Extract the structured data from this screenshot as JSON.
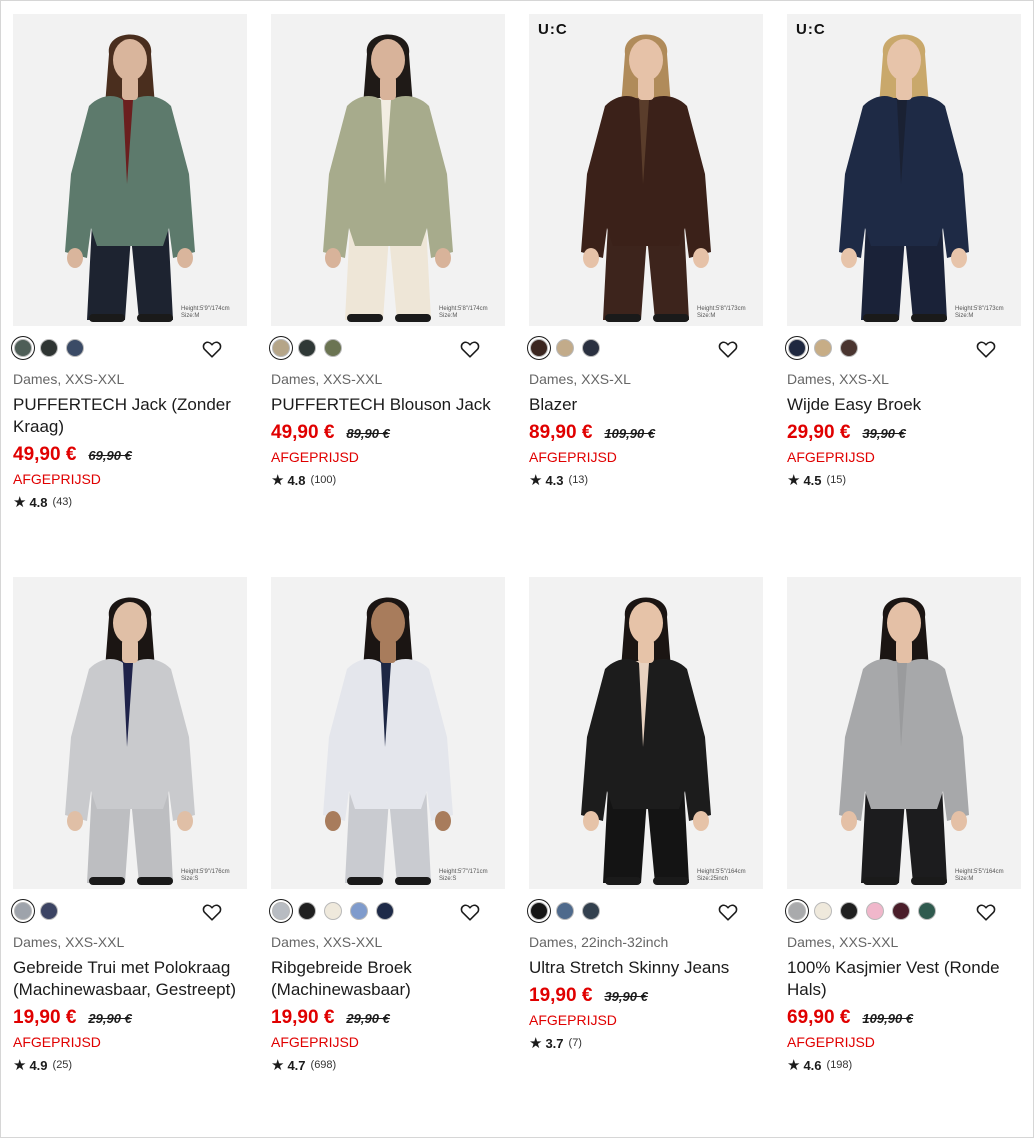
{
  "colors": {
    "sale_red": "#e00000",
    "text_dark": "#1b1b1b",
    "text_muted": "#666666",
    "image_bg": "#f2f2f2"
  },
  "icons": {
    "favorite": "heart-outline-icon",
    "rating": "star-icon"
  },
  "products": [
    {
      "image": {
        "brand_mark": "",
        "height_note": "Height:5'9\"/174cm Size:M",
        "outfit": {
          "top": "#5d7a6c",
          "inner": "#6b1f1f",
          "bottom": "#1d2330",
          "skin": "#d9b59c",
          "hair": "#4a2e1e"
        }
      },
      "swatches": [
        "#4e5e57",
        "#2f3533",
        "#3b4b66"
      ],
      "meta": "Dames, XXS-XXL",
      "name": "PUFFERTECH Jack (Zonder Kraag)",
      "price": "49,90 €",
      "old_price": "69,90 €",
      "tag": "AFGEPRIJSD",
      "rating": "4.8",
      "reviews": "(43)"
    },
    {
      "image": {
        "brand_mark": "",
        "height_note": "Height:5'8\"/174cm Size:M",
        "outfit": {
          "top": "#a7ab8c",
          "inner": "#f2ede2",
          "bottom": "#eee6d7",
          "skin": "#d8b39a",
          "hair": "#1f1a17"
        }
      },
      "swatches": [
        "#b5a588",
        "#2f3836",
        "#6b7452"
      ],
      "meta": "Dames, XXS-XXL",
      "name": "PUFFERTECH Blouson Jack",
      "price": "49,90 €",
      "old_price": "89,90 €",
      "tag": "AFGEPRIJSD",
      "rating": "4.8",
      "reviews": "(100)"
    },
    {
      "image": {
        "brand_mark": "U:C",
        "height_note": "Height:5'8\"/173cm Size:M",
        "outfit": {
          "top": "#3b2119",
          "inner": "#5a3d2b",
          "bottom": "#3d241c",
          "skin": "#e6c2a8",
          "hair": "#b08b5a"
        }
      },
      "swatches": [
        "#3b2620",
        "#c2ab8a",
        "#2a3040"
      ],
      "meta": "Dames, XXS-XL",
      "name": "Blazer",
      "price": "89,90 €",
      "old_price": "109,90 €",
      "tag": "AFGEPRIJSD",
      "rating": "4.3",
      "reviews": "(13)"
    },
    {
      "image": {
        "brand_mark": "U:C",
        "height_note": "Height:5'8\"/173cm Size:M",
        "outfit": {
          "top": "#1e2a45",
          "inner": "#1a2133",
          "bottom": "#1a2238",
          "skin": "#e7c4aa",
          "hair": "#c9a86b"
        }
      },
      "swatches": [
        "#1f2840",
        "#c7ad86",
        "#4a3530"
      ],
      "meta": "Dames, XXS-XL",
      "name": "Wijde Easy Broek",
      "price": "29,90 €",
      "old_price": "39,90 €",
      "tag": "AFGEPRIJSD",
      "rating": "4.5",
      "reviews": "(15)"
    },
    {
      "image": {
        "brand_mark": "",
        "height_note": "Height:5'9\"/176cm Size:S",
        "outfit": {
          "top": "#c9cacd",
          "inner": "#1f234a",
          "bottom": "#bdbec1",
          "skin": "#e0bfa6",
          "hair": "#1b1513"
        }
      },
      "swatches": [
        "#9ea3ab",
        "#3c4463"
      ],
      "meta": "Dames, XXS-XXL",
      "name": "Gebreide Trui met Polokraag (Machinewasbaar, Gestreept)",
      "price": "19,90 €",
      "old_price": "29,90 €",
      "tag": "AFGEPRIJSD",
      "rating": "4.9",
      "reviews": "(25)"
    },
    {
      "image": {
        "brand_mark": "",
        "height_note": "Height:5'7\"/171cm Size:S",
        "outfit": {
          "top": "#e4e6ec",
          "inner": "#1d2744",
          "bottom": "#c9cbd0",
          "skin": "#a87c5c",
          "hair": "#1b1513"
        }
      },
      "swatches": [
        "#b8bcc2",
        "#1f1f1f",
        "#efe9dc",
        "#7f9bcc",
        "#1e2a48"
      ],
      "meta": "Dames, XXS-XXL",
      "name": "Ribgebreide Broek (Machinewasbaar)",
      "price": "19,90 €",
      "old_price": "29,90 €",
      "tag": "AFGEPRIJSD",
      "rating": "4.7",
      "reviews": "(698)"
    },
    {
      "image": {
        "brand_mark": "",
        "height_note": "Height:5'5\"/164cm Size:25inch",
        "outfit": {
          "top": "#1c1c1c",
          "inner": "#e8d2c0",
          "bottom": "#141414",
          "skin": "#e6c3a8",
          "hair": "#1b1513"
        }
      },
      "swatches": [
        "#151515",
        "#4f6a8c",
        "#33404e"
      ],
      "meta": "Dames, 22inch-32inch",
      "name": "Ultra Stretch Skinny Jeans",
      "price": "19,90 €",
      "old_price": "39,90 €",
      "tag": "AFGEPRIJSD",
      "rating": "3.7",
      "reviews": "(7)"
    },
    {
      "image": {
        "brand_mark": "",
        "height_note": "Height:5'5\"/164cm Size:M",
        "outfit": {
          "top": "#a7a8aa",
          "inner": "#9a9b9d",
          "bottom": "#1c1c1e",
          "skin": "#e4c0a6",
          "hair": "#1b1513"
        }
      },
      "swatches": [
        "#a9aaac",
        "#efe9dc",
        "#1f1f1f",
        "#f0b7cb",
        "#4a1e2a",
        "#2f5a4e"
      ],
      "meta": "Dames, XXS-XXL",
      "name": "100% Kasjmier Vest (Ronde Hals)",
      "price": "69,90 €",
      "old_price": "109,90 €",
      "tag": "AFGEPRIJSD",
      "rating": "4.6",
      "reviews": "(198)"
    }
  ]
}
